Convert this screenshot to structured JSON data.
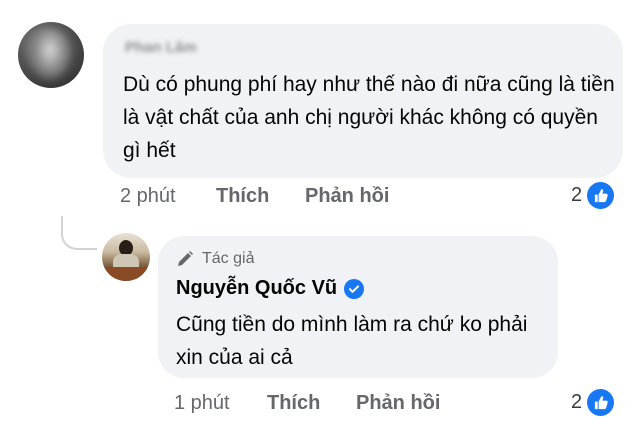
{
  "comment": {
    "author_blurred": "Phan Lâm",
    "text": "Dù có phung phí  hay như thế nào đi nữa cũng là tiền là vật chất của anh chị người khác không có quyền gì hết",
    "time": "2 phút",
    "like_label": "Thích",
    "reply_label": "Phản hồi",
    "reaction_count": "2",
    "reaction_icon": "like-icon"
  },
  "reply": {
    "badge_label": "Tác giả",
    "badge_icon": "pencil-icon",
    "author": "Nguyễn Quốc Vũ",
    "verified_icon": "verified-badge-icon",
    "text": "Cũng tiền do mình làm ra chứ ko phải xin của ai cả",
    "time": "1 phút",
    "like_label": "Thích",
    "reply_label": "Phản hồi",
    "reaction_count": "2",
    "reaction_icon": "like-icon"
  },
  "colors": {
    "bubble_bg": "#f0f2f5",
    "meta_text": "#65676b",
    "like_blue": "#1877f2",
    "thread_line": "#d0d2d6"
  }
}
